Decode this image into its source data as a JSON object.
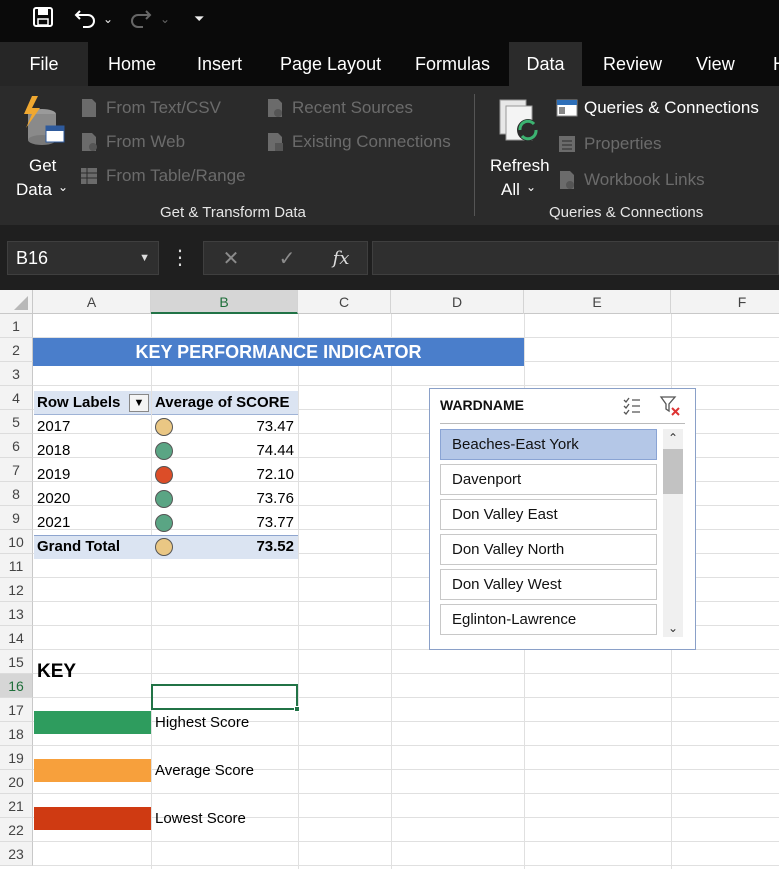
{
  "ribbon_tabs": [
    "File",
    "Home",
    "Insert",
    "Page Layout",
    "Formulas",
    "Data",
    "Review",
    "View",
    "H"
  ],
  "ribbon": {
    "get_data_line1": "Get",
    "get_data_line2": "Data",
    "from_text_csv": "From Text/CSV",
    "from_web": "From Web",
    "from_table_range": "From Table/Range",
    "recent_sources": "Recent Sources",
    "existing_connections": "Existing Connections",
    "group1_label": "Get & Transform Data",
    "refresh_line1": "Refresh",
    "refresh_line2": "All",
    "queries_connections": "Queries & Connections",
    "properties": "Properties",
    "workbook_links": "Workbook Links",
    "group2_label": "Queries & Connections"
  },
  "formula_bar": {
    "name_box": "B16",
    "fx": "fx",
    "more": "⋮",
    "cancel": "✕",
    "enter": "✓",
    "formula_value": ""
  },
  "columns": [
    "A",
    "B",
    "C",
    "D",
    "E",
    "F"
  ],
  "rows": [
    "1",
    "2",
    "3",
    "4",
    "5",
    "6",
    "7",
    "8",
    "9",
    "10",
    "11",
    "12",
    "13",
    "14",
    "15",
    "16",
    "17",
    "18",
    "19",
    "20",
    "21",
    "22",
    "23"
  ],
  "kpi_title": "KEY PERFORMANCE INDICATOR",
  "pivot": {
    "header_row_labels": "Row Labels",
    "header_value": "Average of SCORE",
    "rows": [
      {
        "label": "2017",
        "value": "73.47",
        "status": "average"
      },
      {
        "label": "2018",
        "value": "74.44",
        "status": "highest"
      },
      {
        "label": "2019",
        "value": "72.10",
        "status": "lowest"
      },
      {
        "label": "2020",
        "value": "73.76",
        "status": "highest"
      },
      {
        "label": "2021",
        "value": "73.77",
        "status": "highest"
      }
    ],
    "total_label": "Grand Total",
    "total_value": "73.52",
    "total_status": "average"
  },
  "key": {
    "title": "KEY",
    "highest": "Highest Score",
    "average": "Average Score",
    "lowest": "Lowest Score"
  },
  "colors": {
    "highest_swatch": "#2e9c5e",
    "average_swatch": "#f7a03c",
    "lowest_swatch": "#cf3a12",
    "dot_highest": "#5aa584",
    "dot_average": "#eac784",
    "dot_lowest": "#dc4d28",
    "kpi_header": "#4a7ecb"
  },
  "slicer": {
    "title": "WARDNAME",
    "items": [
      {
        "label": "Beaches-East York",
        "selected": true
      },
      {
        "label": "Davenport",
        "selected": false
      },
      {
        "label": "Don Valley East",
        "selected": false
      },
      {
        "label": "Don Valley North",
        "selected": false
      },
      {
        "label": "Don Valley West",
        "selected": false
      },
      {
        "label": "Eglinton-Lawrence",
        "selected": false
      }
    ]
  }
}
